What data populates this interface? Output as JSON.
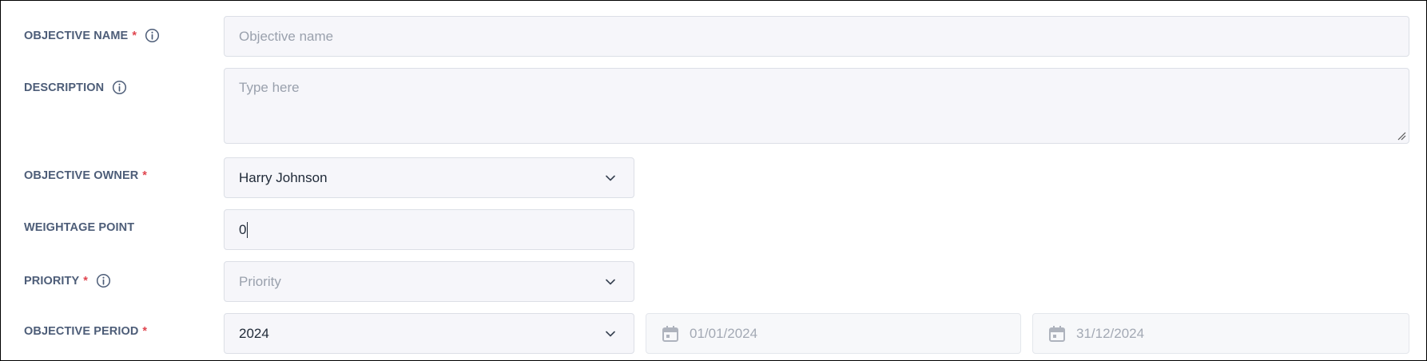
{
  "form": {
    "objective_name": {
      "label": "OBJECTIVE NAME",
      "required": "*",
      "placeholder": "Objective name"
    },
    "description": {
      "label": "DESCRIPTION",
      "placeholder": "Type here"
    },
    "objective_owner": {
      "label": "OBJECTIVE OWNER",
      "required": "*",
      "value": "Harry Johnson"
    },
    "weightage_point": {
      "label": "WEIGHTAGE POINT",
      "value": "0"
    },
    "priority": {
      "label": "PRIORITY",
      "required": "*",
      "placeholder": "Priority"
    },
    "objective_period": {
      "label": "OBJECTIVE PERIOD",
      "required": "*",
      "value": "2024",
      "start_date": "01/01/2024",
      "end_date": "31/12/2024"
    }
  },
  "icons": {
    "info": "info-icon",
    "chevron": "chevron-down-icon",
    "calendar": "calendar-icon",
    "resize": "resize-handle-icon"
  },
  "colors": {
    "label": "#4d5d78",
    "required": "#e0454f",
    "field_bg": "#f6f6fa",
    "field_border": "#dcdfe6",
    "placeholder": "#9aa1ad"
  }
}
